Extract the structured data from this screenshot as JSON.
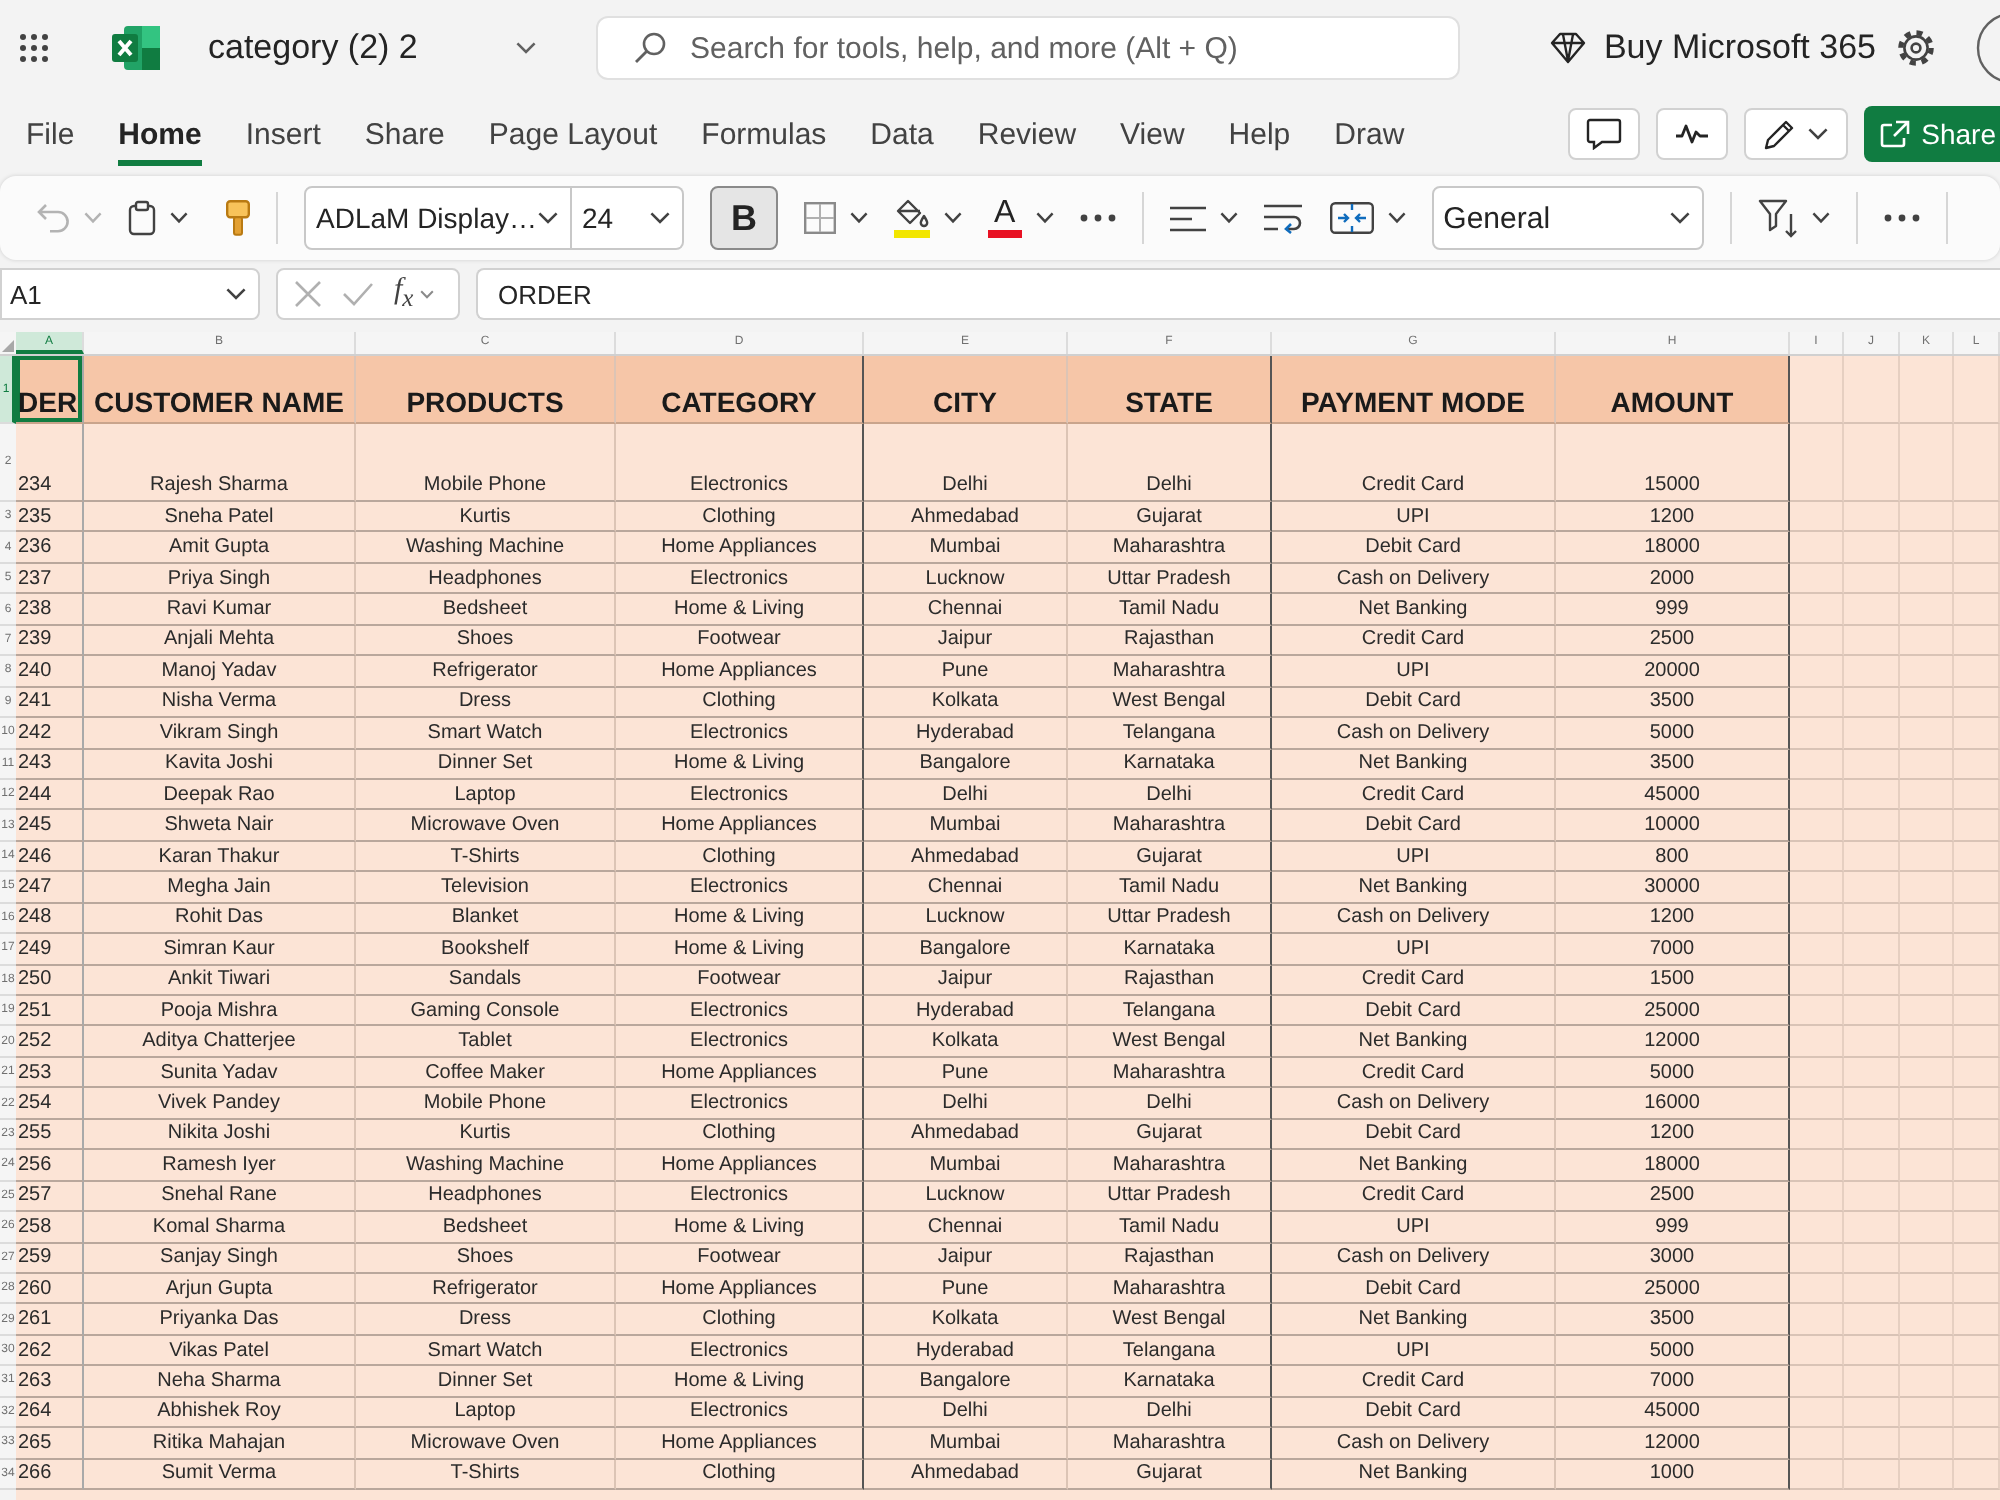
{
  "app_bar": {
    "title": "category (2) 2",
    "search": {
      "placeholder": "Search for tools, help, and more (Alt + Q)"
    },
    "buy_button": "Buy Microsoft 365"
  },
  "menu_tabs": [
    {
      "label": "File",
      "selected": false
    },
    {
      "label": "Home",
      "selected": true
    },
    {
      "label": "Insert",
      "selected": false
    },
    {
      "label": "Share",
      "selected": false
    },
    {
      "label": "Page Layout",
      "selected": false
    },
    {
      "label": "Formulas",
      "selected": false
    },
    {
      "label": "Data",
      "selected": false
    },
    {
      "label": "Review",
      "selected": false
    },
    {
      "label": "View",
      "selected": false
    },
    {
      "label": "Help",
      "selected": false
    },
    {
      "label": "Draw",
      "selected": false
    }
  ],
  "share_button": "Share",
  "toolbar": {
    "undo": {
      "disabled": true
    },
    "font": "ADLaM Display…",
    "font_size": "24",
    "bold": {
      "label": "B",
      "on": true
    },
    "font_color_glyph": "A",
    "number_format": "General"
  },
  "formula_bar": {
    "name_box": "A1",
    "cancel": {
      "disabled": true
    },
    "enter": {
      "disabled": true
    },
    "function_label": "f$_{x}$",
    "formula": "ORDER"
  },
  "sheet": {
    "columns": [
      {
        "letter": "A",
        "selected": true
      },
      {
        "letter": "B",
        "selected": false
      },
      {
        "letter": "C",
        "selected": false
      },
      {
        "letter": "D",
        "selected": false
      },
      {
        "letter": "E",
        "selected": false
      },
      {
        "letter": "F",
        "selected": false
      },
      {
        "letter": "G",
        "selected": false
      },
      {
        "letter": "H",
        "selected": false
      },
      {
        "letter": "I",
        "selected": false
      },
      {
        "letter": "J",
        "selected": false
      },
      {
        "letter": "K",
        "selected": false
      },
      {
        "letter": "L",
        "selected": false
      }
    ],
    "header_row": {
      "number": "1",
      "selected": true,
      "cells": [
        "DER",
        "CUSTOMER NAME",
        "PRODUCTS",
        "CATEGORY",
        "CITY",
        "STATE",
        "PAYMENT MODE",
        "AMOUNT"
      ]
    },
    "rows": [
      {
        "number": "2",
        "selected": false,
        "cells": [
          "234",
          "Rajesh Sharma",
          "Mobile Phone",
          "Electronics",
          "Delhi",
          "Delhi",
          "Credit Card",
          "15000"
        ]
      },
      {
        "number": "3",
        "selected": false,
        "cells": [
          "235",
          "Sneha Patel",
          "Kurtis",
          "Clothing",
          "Ahmedabad",
          "Gujarat",
          "UPI",
          "1200"
        ]
      },
      {
        "number": "4",
        "selected": false,
        "cells": [
          "236",
          "Amit Gupta",
          "Washing Machine",
          "Home Appliances",
          "Mumbai",
          "Maharashtra",
          "Debit Card",
          "18000"
        ]
      },
      {
        "number": "5",
        "selected": false,
        "cells": [
          "237",
          "Priya Singh",
          "Headphones",
          "Electronics",
          "Lucknow",
          "Uttar Pradesh",
          "Cash on Delivery",
          "2000"
        ]
      },
      {
        "number": "6",
        "selected": false,
        "cells": [
          "238",
          "Ravi Kumar",
          "Bedsheet",
          "Home & Living",
          "Chennai",
          "Tamil Nadu",
          "Net Banking",
          "999"
        ]
      },
      {
        "number": "7",
        "selected": false,
        "cells": [
          "239",
          "Anjali Mehta",
          "Shoes",
          "Footwear",
          "Jaipur",
          "Rajasthan",
          "Credit Card",
          "2500"
        ]
      },
      {
        "number": "8",
        "selected": false,
        "cells": [
          "240",
          "Manoj Yadav",
          "Refrigerator",
          "Home Appliances",
          "Pune",
          "Maharashtra",
          "UPI",
          "20000"
        ]
      },
      {
        "number": "9",
        "selected": false,
        "cells": [
          "241",
          "Nisha Verma",
          "Dress",
          "Clothing",
          "Kolkata",
          "West Bengal",
          "Debit Card",
          "3500"
        ]
      },
      {
        "number": "10",
        "selected": false,
        "cells": [
          "242",
          "Vikram Singh",
          "Smart Watch",
          "Electronics",
          "Hyderabad",
          "Telangana",
          "Cash on Delivery",
          "5000"
        ]
      },
      {
        "number": "11",
        "selected": false,
        "cells": [
          "243",
          "Kavita Joshi",
          "Dinner Set",
          "Home & Living",
          "Bangalore",
          "Karnataka",
          "Net Banking",
          "3500"
        ]
      },
      {
        "number": "12",
        "selected": false,
        "cells": [
          "244",
          "Deepak Rao",
          "Laptop",
          "Electronics",
          "Delhi",
          "Delhi",
          "Credit Card",
          "45000"
        ]
      },
      {
        "number": "13",
        "selected": false,
        "cells": [
          "245",
          "Shweta Nair",
          "Microwave Oven",
          "Home Appliances",
          "Mumbai",
          "Maharashtra",
          "Debit Card",
          "10000"
        ]
      },
      {
        "number": "14",
        "selected": false,
        "cells": [
          "246",
          "Karan Thakur",
          "T-Shirts",
          "Clothing",
          "Ahmedabad",
          "Gujarat",
          "UPI",
          "800"
        ]
      },
      {
        "number": "15",
        "selected": false,
        "cells": [
          "247",
          "Megha Jain",
          "Television",
          "Electronics",
          "Chennai",
          "Tamil Nadu",
          "Net Banking",
          "30000"
        ]
      },
      {
        "number": "16",
        "selected": false,
        "cells": [
          "248",
          "Rohit Das",
          "Blanket",
          "Home & Living",
          "Lucknow",
          "Uttar Pradesh",
          "Cash on Delivery",
          "1200"
        ]
      },
      {
        "number": "17",
        "selected": false,
        "cells": [
          "249",
          "Simran Kaur",
          "Bookshelf",
          "Home & Living",
          "Bangalore",
          "Karnataka",
          "UPI",
          "7000"
        ]
      },
      {
        "number": "18",
        "selected": false,
        "cells": [
          "250",
          "Ankit Tiwari",
          "Sandals",
          "Footwear",
          "Jaipur",
          "Rajasthan",
          "Credit Card",
          "1500"
        ]
      },
      {
        "number": "19",
        "selected": false,
        "cells": [
          "251",
          "Pooja Mishra",
          "Gaming Console",
          "Electronics",
          "Hyderabad",
          "Telangana",
          "Debit Card",
          "25000"
        ]
      },
      {
        "number": "20",
        "selected": false,
        "cells": [
          "252",
          "Aditya Chatterjee",
          "Tablet",
          "Electronics",
          "Kolkata",
          "West Bengal",
          "Net Banking",
          "12000"
        ]
      },
      {
        "number": "21",
        "selected": false,
        "cells": [
          "253",
          "Sunita Yadav",
          "Coffee Maker",
          "Home Appliances",
          "Pune",
          "Maharashtra",
          "Credit Card",
          "5000"
        ]
      },
      {
        "number": "22",
        "selected": false,
        "cells": [
          "254",
          "Vivek Pandey",
          "Mobile Phone",
          "Electronics",
          "Delhi",
          "Delhi",
          "Cash on Delivery",
          "16000"
        ]
      },
      {
        "number": "23",
        "selected": false,
        "cells": [
          "255",
          "Nikita Joshi",
          "Kurtis",
          "Clothing",
          "Ahmedabad",
          "Gujarat",
          "Debit Card",
          "1200"
        ]
      },
      {
        "number": "24",
        "selected": false,
        "cells": [
          "256",
          "Ramesh Iyer",
          "Washing Machine",
          "Home Appliances",
          "Mumbai",
          "Maharashtra",
          "Net Banking",
          "18000"
        ]
      },
      {
        "number": "25",
        "selected": false,
        "cells": [
          "257",
          "Snehal Rane",
          "Headphones",
          "Electronics",
          "Lucknow",
          "Uttar Pradesh",
          "Credit Card",
          "2500"
        ]
      },
      {
        "number": "26",
        "selected": false,
        "cells": [
          "258",
          "Komal Sharma",
          "Bedsheet",
          "Home & Living",
          "Chennai",
          "Tamil Nadu",
          "UPI",
          "999"
        ]
      },
      {
        "number": "27",
        "selected": false,
        "cells": [
          "259",
          "Sanjay Singh",
          "Shoes",
          "Footwear",
          "Jaipur",
          "Rajasthan",
          "Cash on Delivery",
          "3000"
        ]
      },
      {
        "number": "28",
        "selected": false,
        "cells": [
          "260",
          "Arjun Gupta",
          "Refrigerator",
          "Home Appliances",
          "Pune",
          "Maharashtra",
          "Debit Card",
          "25000"
        ]
      },
      {
        "number": "29",
        "selected": false,
        "cells": [
          "261",
          "Priyanka Das",
          "Dress",
          "Clothing",
          "Kolkata",
          "West Bengal",
          "Net Banking",
          "3500"
        ]
      },
      {
        "number": "30",
        "selected": false,
        "cells": [
          "262",
          "Vikas Patel",
          "Smart Watch",
          "Electronics",
          "Hyderabad",
          "Telangana",
          "UPI",
          "5000"
        ]
      },
      {
        "number": "31",
        "selected": false,
        "cells": [
          "263",
          "Neha Sharma",
          "Dinner Set",
          "Home & Living",
          "Bangalore",
          "Karnataka",
          "Credit Card",
          "7000"
        ]
      },
      {
        "number": "32",
        "selected": false,
        "cells": [
          "264",
          "Abhishek Roy",
          "Laptop",
          "Electronics",
          "Delhi",
          "Delhi",
          "Debit Card",
          "45000"
        ]
      },
      {
        "number": "33",
        "selected": false,
        "cells": [
          "265",
          "Ritika Mahajan",
          "Microwave Oven",
          "Home Appliances",
          "Mumbai",
          "Maharashtra",
          "Cash on Delivery",
          "12000"
        ]
      },
      {
        "number": "34",
        "selected": false,
        "cells": [
          "266",
          "Sumit Verma",
          "T-Shirts",
          "Clothing",
          "Ahmedabad",
          "Gujarat",
          "Net Banking",
          "1000"
        ]
      }
    ]
  }
}
